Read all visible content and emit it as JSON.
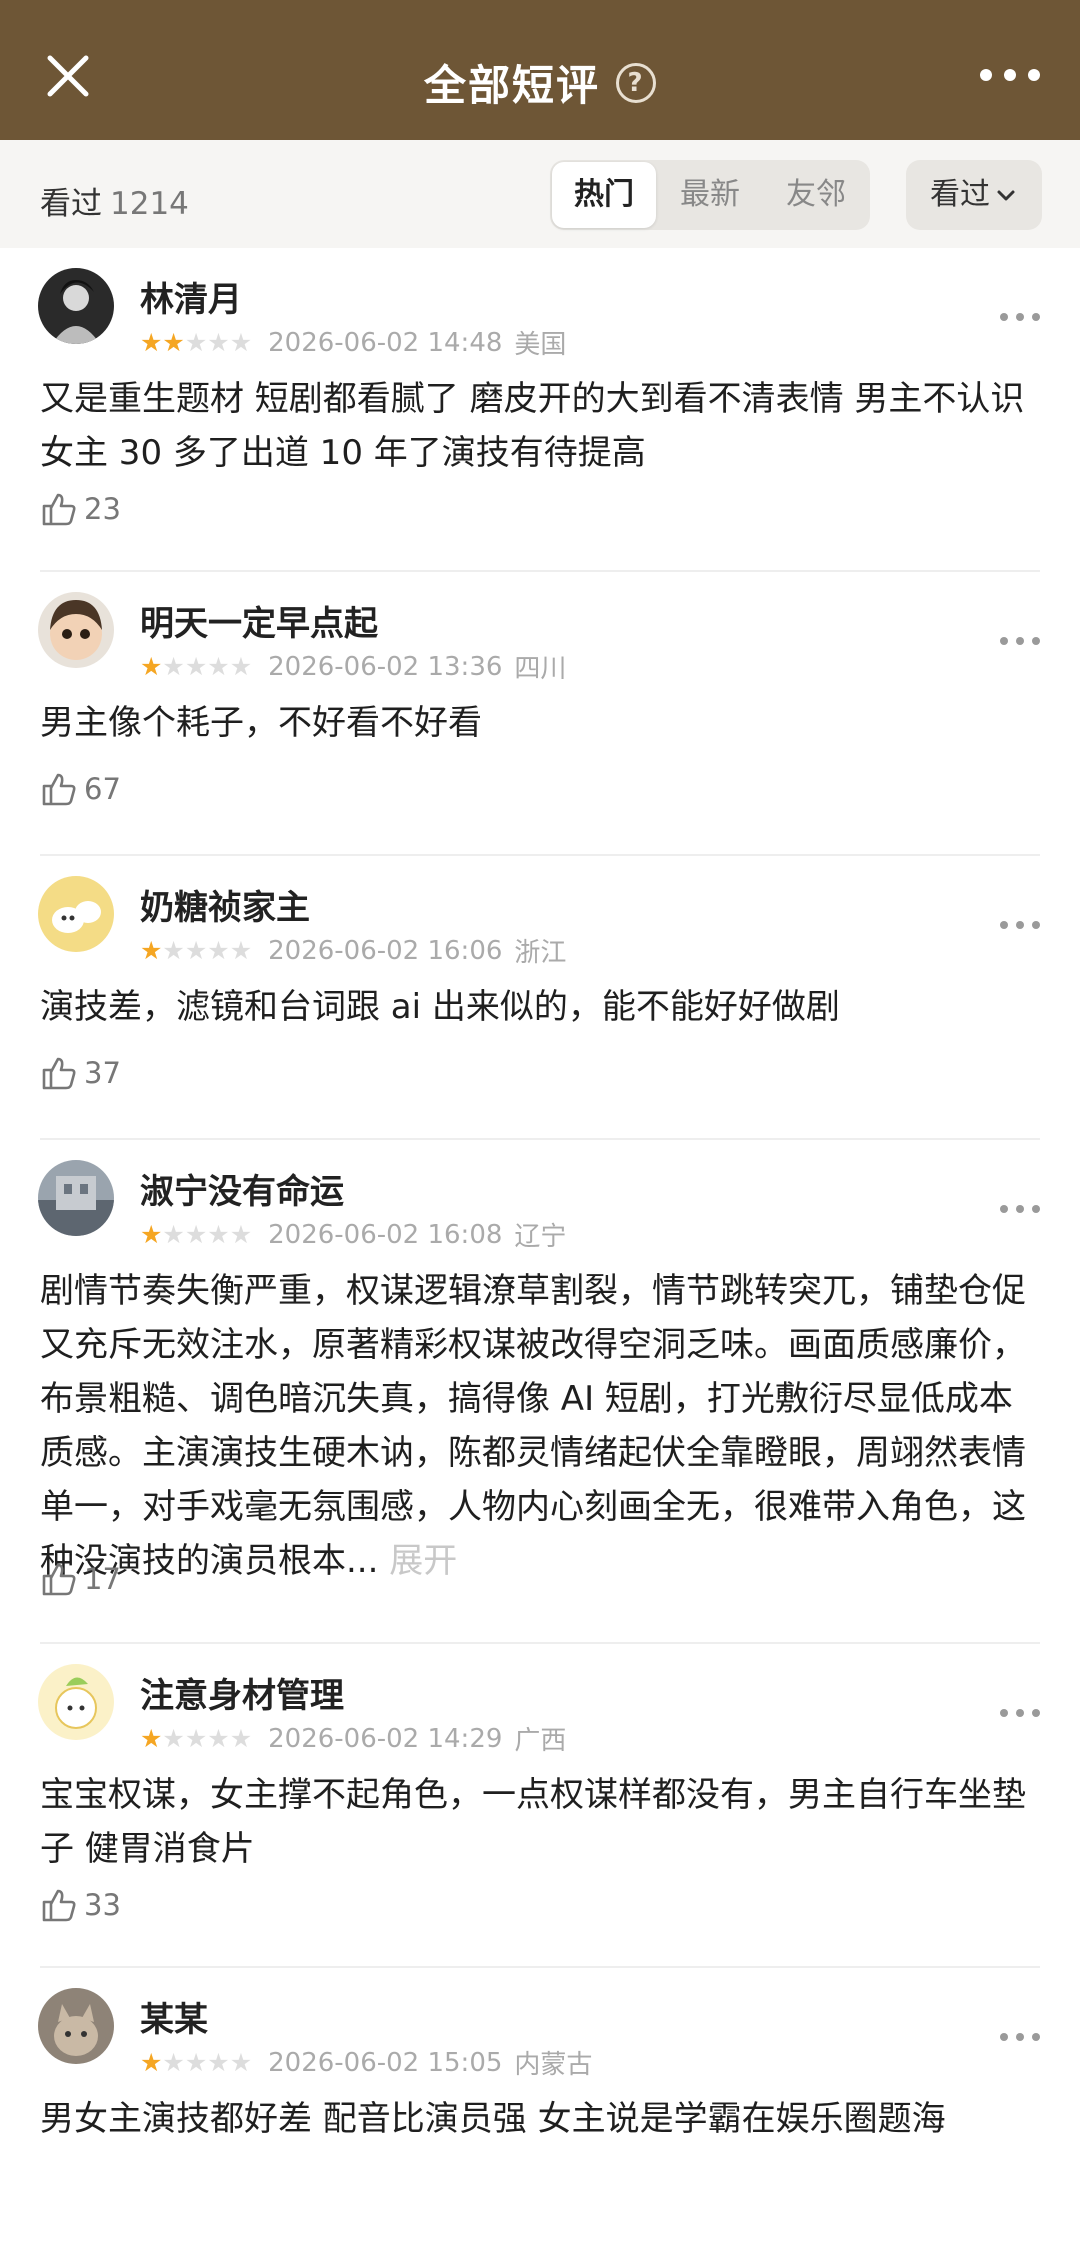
{
  "header": {
    "title": "全部短评",
    "help_icon": "question-icon",
    "close_icon": "close-icon",
    "more_icon": "more-icon"
  },
  "filter": {
    "seen_label": "看过",
    "seen_count": "1214",
    "tabs": [
      {
        "label": "热门",
        "active": true
      },
      {
        "label": "最新",
        "active": false
      },
      {
        "label": "友邻",
        "active": false
      }
    ],
    "sort_label": "看过"
  },
  "comments": [
    {
      "name": "林清月",
      "stars": 2,
      "time": "2026-06-02 14:48",
      "loc": "美国",
      "text": "又是重生题材 短剧都看腻了 磨皮开的大到看不清表情 男主不认识 女主 30 多了出道 10 年了演技有待提高",
      "likes": "23"
    },
    {
      "name": "明天一定早点起",
      "stars": 1,
      "time": "2026-06-02 13:36",
      "loc": "四川",
      "text": "男主像个耗子，不好看不好看",
      "likes": "67"
    },
    {
      "name": "奶糖祯家主",
      "stars": 1,
      "time": "2026-06-02 16:06",
      "loc": "浙江",
      "text": "演技差，滤镜和台词跟 ai 出来似的，能不能好好做剧",
      "likes": "37"
    },
    {
      "name": "淑宁没有命运",
      "stars": 1,
      "time": "2026-06-02 16:08",
      "loc": "辽宁",
      "text": "剧情节奏失衡严重，权谋逻辑潦草割裂，情节跳转突兀，铺垫仓促又充斥无效注水，原著精彩权谋被改得空洞乏味。画面质感廉价，布景粗糙、调色暗沉失真，搞得像 AI 短剧，打光敷衍尽显低成本质感。主演演技生硬木讷，陈都灵情绪起伏全靠瞪眼，周翊然表情单一，对手戏毫无氛围感，人物内心刻画全无，很难带入角色，这种没演技的演员根本...",
      "expand": "展开",
      "likes": "17"
    },
    {
      "name": "注意身材管理",
      "stars": 1,
      "time": "2026-06-02 14:29",
      "loc": "广西",
      "text": "宝宝权谋，女主撑不起角色，一点权谋样都没有，男主自行车坐垫子 健胃消食片",
      "likes": "33"
    },
    {
      "name": "某某",
      "stars": 1,
      "time": "2026-06-02 15:05",
      "loc": "内蒙古",
      "text": "男女主演技都好差 配音比演员强 女主说是学霸在娱乐圈题海",
      "likes": ""
    }
  ]
}
